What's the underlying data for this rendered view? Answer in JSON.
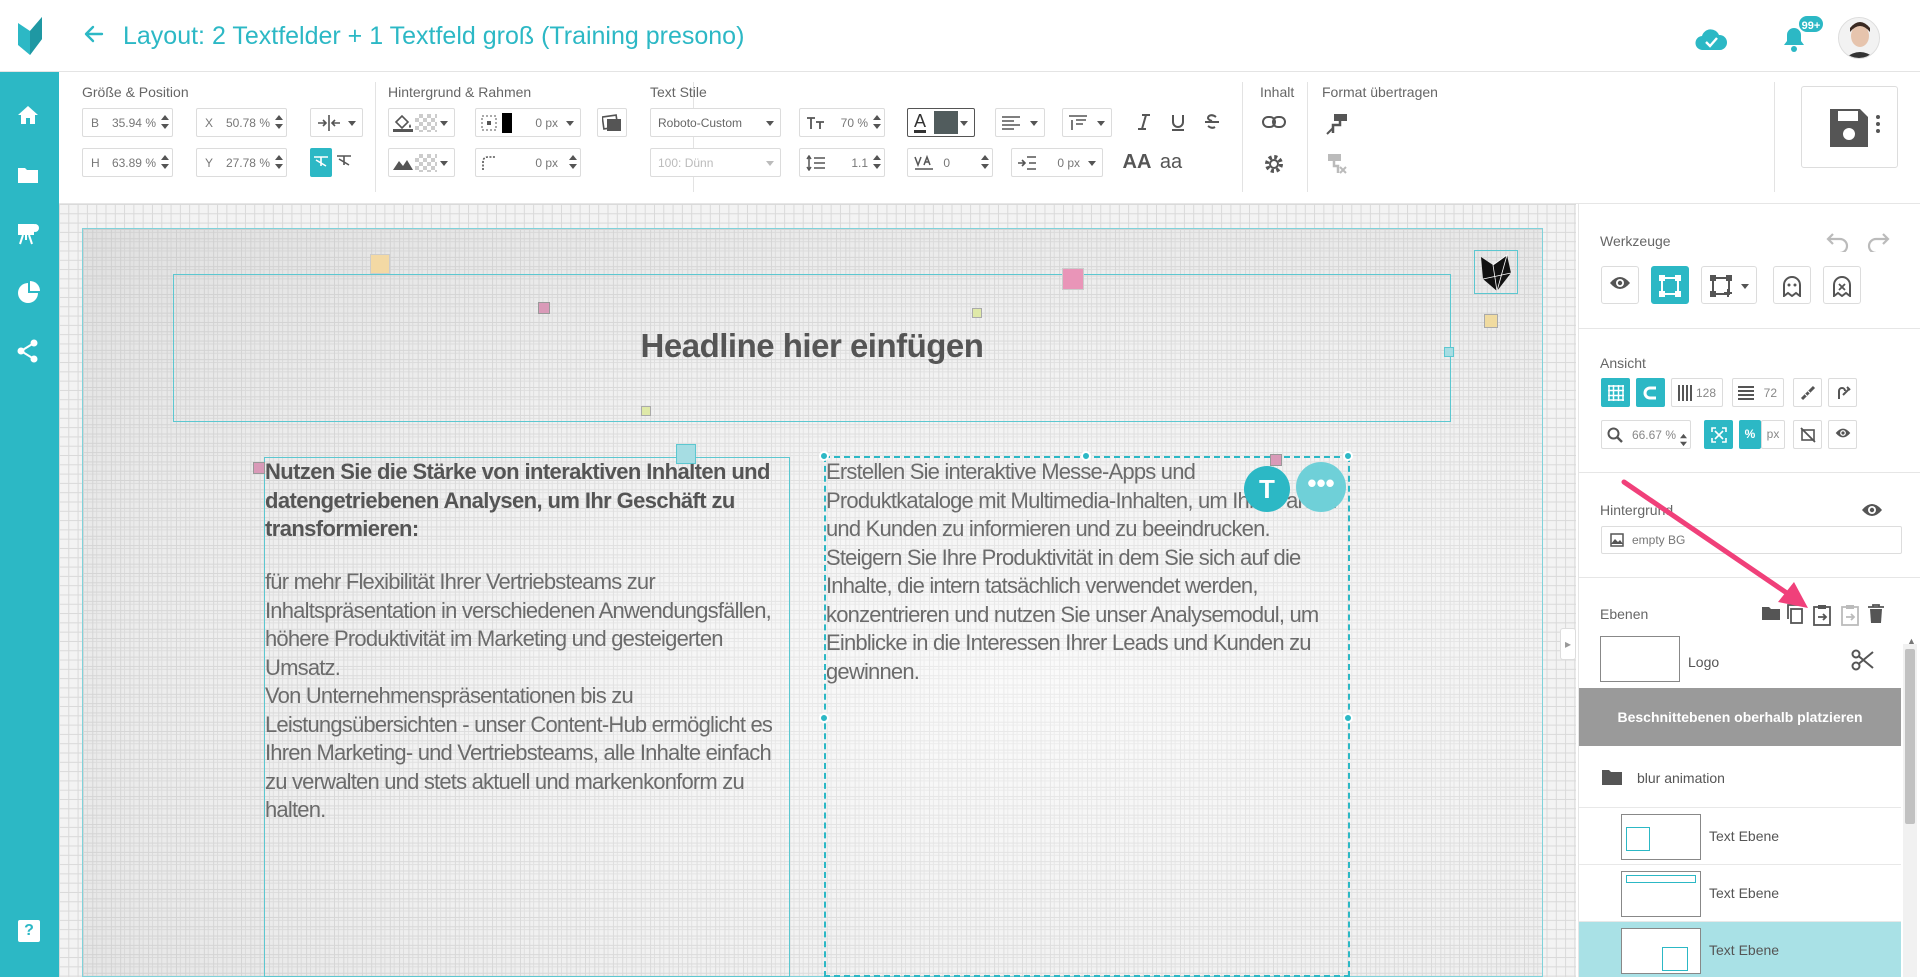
{
  "header": {
    "back_icon": "arrow-left-icon",
    "title": "Layout: 2 Textfelder + 1 Textfeld groß (Training presono)",
    "notification_badge": "99+"
  },
  "colors": {
    "accent": "#2cb8c5",
    "accent_light": "#a9e1e6",
    "clip_bar": "#9a9a9a"
  },
  "sidebar": {
    "items": [
      "home-icon",
      "folder-icon",
      "presentation-icon",
      "pie-chart-icon",
      "share-icon"
    ],
    "help": "?"
  },
  "toolbar": {
    "size_position": {
      "label": "Größe & Position",
      "b_label": "B",
      "b_value": "35.94 %",
      "x_label": "X",
      "x_value": "50.78 %",
      "h_label": "H",
      "h_value": "63.89 %",
      "y_label": "Y",
      "y_value": "27.78 %"
    },
    "background_border": {
      "label": "Hintergrund & Rahmen",
      "border_width": "0 px",
      "radius": "0 px"
    },
    "text_style": {
      "label": "Text Stile",
      "font_family": "Roboto-Custom",
      "font_weight": "100: Dünn",
      "font_size": "70 %",
      "line_height": "1.1",
      "letter_spacing": "0",
      "indent": "0 px",
      "case_upper": "AA",
      "case_lower": "aa",
      "color_letter": "A"
    },
    "content": {
      "label": "Inhalt"
    },
    "format_transfer": {
      "label": "Format übertragen"
    }
  },
  "canvas": {
    "headline": "Headline hier einfügen",
    "left_bold": "Nutzen Sie die Stärke von interaktiven Inhalten und datengetriebenen Analysen, um Ihr Geschäft zu transformieren:",
    "left_body": "für mehr Flexibilität Ihrer Vertriebsteams zur Inhaltspräsentation in verschiedenen Anwendungsfällen, höhere Produktivität im Marketing und gesteigerten Umsatz.\nVon Unternehmenspräsentationen bis zu Leistungsübersichten - unser Content-Hub ermöglicht es Ihren Marketing- und Vertriebsteams, alle Inhalte einfach zu verwalten und stets aktuell und markenkonform zu halten.",
    "right_body": "Erstellen Sie interaktive Messe-Apps und Produktkataloge mit Multimedia-Inhalten, um Ihre Partner und Kunden zu informieren und zu beeindrucken. Steigern Sie Ihre Produktivität in dem Sie sich auf die Inhalte, die intern tatsächlich verwendet werden, konzentrieren und nutzen Sie unser Analysemodul, um Einblicke in die Interessen Ihrer Leads und Kunden zu gewinnen.",
    "fab_text": "T",
    "fab_more": "•••"
  },
  "panel": {
    "tools": {
      "label": "Werkzeuge"
    },
    "view": {
      "label": "Ansicht",
      "columns": "128",
      "rows": "72",
      "zoom": "66.67 %",
      "unit_percent": "%",
      "unit_px": "px"
    },
    "background": {
      "label": "Hintergrund",
      "value": "empty BG"
    },
    "layers": {
      "label": "Ebenen",
      "top_layer": "Logo",
      "clip_button": "Beschnittebenen oberhalb platzieren",
      "folder": "blur animation",
      "items": [
        {
          "name": "Text Ebene",
          "selected": false
        },
        {
          "name": "Text Ebene",
          "selected": false
        },
        {
          "name": "Text Ebene",
          "selected": true
        }
      ]
    }
  }
}
